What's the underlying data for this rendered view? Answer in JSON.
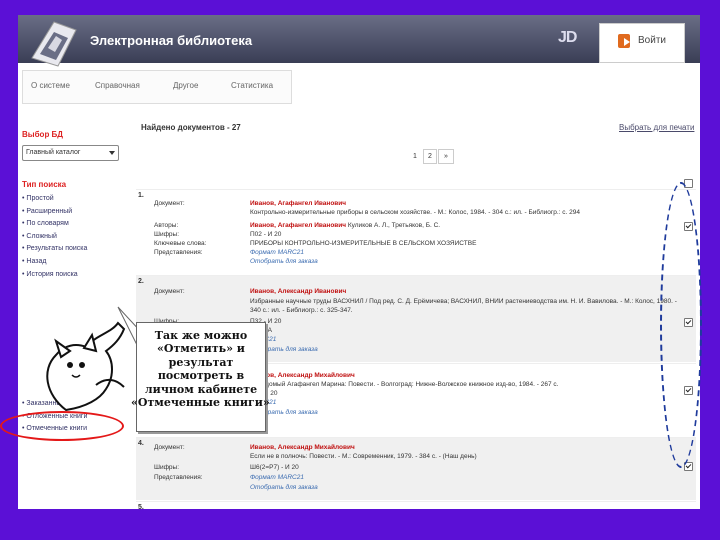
{
  "header": {
    "title": "Электронная библиотека",
    "login_label": "Войти"
  },
  "nav": {
    "items": [
      "О системе",
      "Справочная",
      "Другое",
      "Статистика"
    ]
  },
  "sidebar": {
    "db_heading": "Выбор БД",
    "db_selected": "Главный каталог",
    "search_heading": "Тип поиска",
    "search_types": [
      "Простой",
      "Расширенный",
      "По словарям",
      "Сложный",
      "Результаты поиска",
      "Назад",
      "История поиска"
    ],
    "bottom_items": [
      "Заказанные книги",
      "Отложенные книги",
      "Отмеченные книги"
    ]
  },
  "results": {
    "found_label": "Найдено документов - 27",
    "mark_all_label": "Выбрать для печати",
    "pages": [
      "1",
      "2",
      "»"
    ]
  },
  "records": [
    {
      "num": "1.",
      "rows": [
        {
          "label": "Документ:",
          "value_red": "Иванов, Агафангел Иванович",
          "value": "Контрольно-измерительные приборы в сельском хозяйстве. - М.: Колос, 1984. - 304 с.: ил. - Библиогр.: с. 294"
        },
        {
          "label": "Авторы:",
          "value_red": "Иванов, Агафангел Иванович",
          "value": "Куликов А. Л., Третьяков, Б. С."
        },
        {
          "label": "Шифры:",
          "value": "П02 - И 20"
        },
        {
          "label": "Ключевые слова:",
          "value": "ПРИБОРЫ КОНТРОЛЬНО-ИЗМЕРИТЕЛЬНЫЕ В СЕЛЬСКОМ ХОЗЯЙСТВЕ"
        },
        {
          "label": "Представления:",
          "value": "Формат MARC21"
        },
        {
          "label": "",
          "value_link": "Отобрать для заказа"
        }
      ]
    },
    {
      "num": "2.",
      "rows": [
        {
          "label": "Документ:",
          "value_red": "Иванов, Александр Иванович",
          "value": "Избранные научные труды ВАСХНИЛ / Под ред. С. Д. Ерёмичева; ВАСХНИЛ, ВНИИ растениеводства им. Н. И. Вавилова. - М.: Колос, 1980. - 340 с.: ил. - Библиогр.: с. 325-347."
        },
        {
          "label": "Шифры:",
          "value": "П32 - И 20"
        },
        {
          "label": "",
          "value": "ЛЕЧНА"
        },
        {
          "label": "",
          "value": "MARC21"
        },
        {
          "label": "",
          "value_link": "Отобрать для заказа"
        }
      ]
    },
    {
      "num": "3.",
      "rows": [
        {
          "label": "",
          "value_red": "Иванов, Александр Михайлович",
          "value": "Неведомый Агафангел Марина: Повести. - Волгоград: Нижне-Волжское книжное изд-во, 1984. - 267 с."
        },
        {
          "label": "",
          "value": "Р2 - И 20"
        },
        {
          "label": "",
          "value": "MARC21"
        },
        {
          "label": "",
          "value_link": "Отобрать для заказа"
        }
      ]
    },
    {
      "num": "4.",
      "rows": [
        {
          "label": "Документ:",
          "value_red": "Иванов, Александр Михайлович",
          "value": "Если не в полночь: Повести. - М.: Современник, 1979. - 384 с. - (Наш день)"
        },
        {
          "label": "Шифры:",
          "value": "Ш6(2=Р7) - И 20"
        },
        {
          "label": "Представления:",
          "value": "Формат MARC21"
        },
        {
          "label": "",
          "value_link": "Отобрать для заказа"
        }
      ]
    },
    {
      "num": "5.",
      "rows": []
    }
  ],
  "callout": {
    "lines": [
      "Так же можно",
      "«Отметить» и",
      "результат",
      "посмотреть в",
      "личном кабинете",
      "«Отмеченные книги»"
    ]
  },
  "colors": {
    "background": "#5b10d6",
    "header": "#4a4e66",
    "accent_red": "#c01010",
    "red_oval": "#e41818",
    "blue_oval": "#1f3b9c"
  }
}
